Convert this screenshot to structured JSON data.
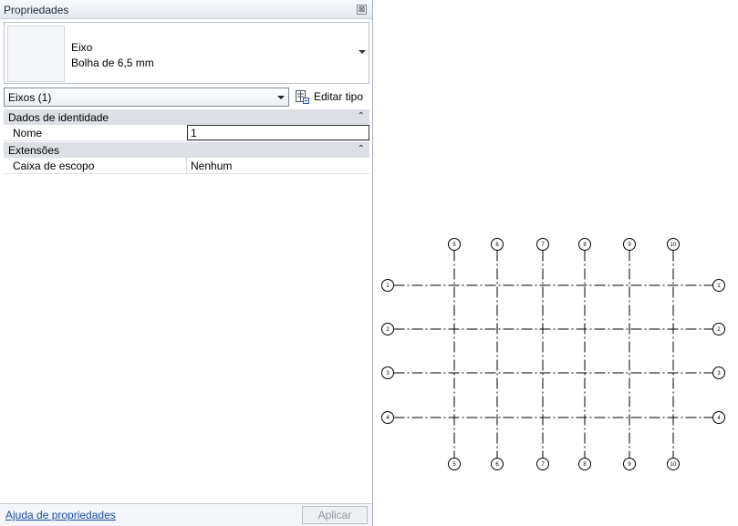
{
  "panel": {
    "title": "Propriedades",
    "close_glyph": "⊠",
    "type_selector": {
      "family": "Eixo",
      "type": "Bolha de 6,5 mm"
    },
    "instance_filter": "Eixos (1)",
    "edit_type_label": "Editar tipo",
    "groups": [
      {
        "title": "Dados de identidade",
        "rows": [
          {
            "name": "Nome",
            "value": "1"
          }
        ]
      },
      {
        "title": "Extensões",
        "rows": [
          {
            "name": "Caixa de escopo",
            "value": "Nenhum"
          }
        ]
      }
    ],
    "footer": {
      "help_link": "Ajuda de propriedades",
      "apply_label": "Aplicar"
    }
  },
  "drawing": {
    "vertical_grid_labels": [
      "5",
      "6",
      "7",
      "8",
      "9",
      "10"
    ],
    "horizontal_grid_labels": [
      "1",
      "2",
      "3",
      "4"
    ],
    "line_color": "#000000",
    "line_style": "dash-dot"
  },
  "icons": {
    "close": "close-icon",
    "dropdown": "chevron-down-icon",
    "edit_type": "edit-type-icon",
    "collapse": "collapse-double-chevron-icon"
  }
}
